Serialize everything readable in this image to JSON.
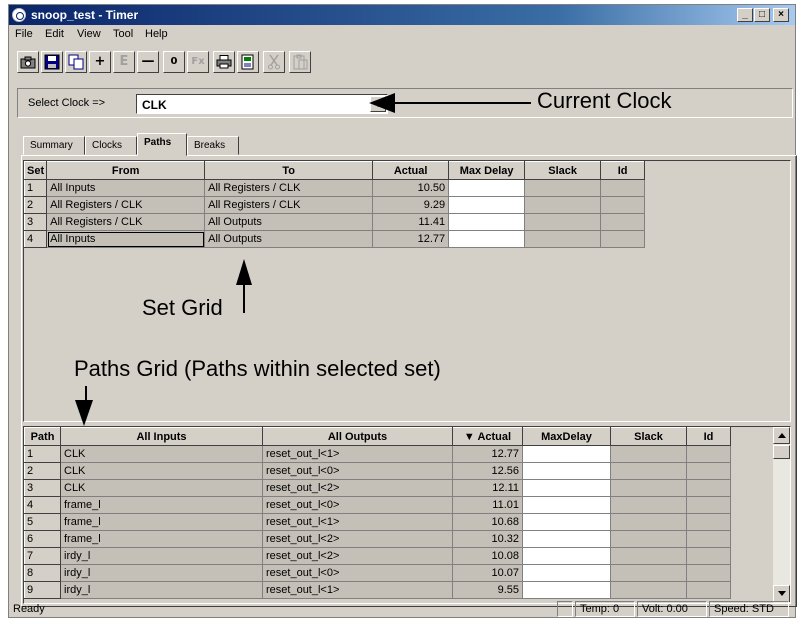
{
  "window": {
    "title": "snoop_test - Timer",
    "controls": {
      "minimize": "_",
      "maximize": "□",
      "close": "×"
    }
  },
  "menu": [
    "File",
    "Edit",
    "View",
    "Tool",
    "Help"
  ],
  "toolbar": {
    "icons": [
      "camera-icon",
      "save-icon",
      "copy-icon",
      "plus-icon",
      "e-icon",
      "minus-icon",
      "zero-icon",
      "fx-icon",
      "print-icon",
      "preview-icon",
      "cut-icon",
      "paste-icon"
    ],
    "labels": [
      "",
      "",
      "",
      "+",
      "E",
      "—",
      "0",
      "Fx",
      "",
      "",
      "",
      ""
    ]
  },
  "clock": {
    "label": "Select Clock =>",
    "value": "CLK"
  },
  "annotations": {
    "current_clock": "Current Clock",
    "set_grid": "Set Grid",
    "paths_grid": "Paths Grid (Paths within selected set)"
  },
  "tabs": [
    {
      "label": "Summary",
      "active": false
    },
    {
      "label": "Clocks",
      "active": false
    },
    {
      "label": "Paths",
      "active": true
    },
    {
      "label": "Breaks",
      "active": false
    }
  ],
  "set_grid": {
    "headers": [
      "Set",
      "From",
      "To",
      "Actual",
      "Max Delay",
      "Slack",
      "Id"
    ],
    "rows": [
      {
        "set": "1",
        "from": "All Inputs",
        "to": "All Registers / CLK",
        "actual": "10.50",
        "max_delay": "",
        "slack": "",
        "id": ""
      },
      {
        "set": "2",
        "from": "All Registers / CLK",
        "to": "All Registers / CLK",
        "actual": "9.29",
        "max_delay": "",
        "slack": "",
        "id": ""
      },
      {
        "set": "3",
        "from": "All Registers / CLK",
        "to": "All Outputs",
        "actual": "11.41",
        "max_delay": "",
        "slack": "",
        "id": ""
      },
      {
        "set": "4",
        "from": "All Inputs",
        "to": "All Outputs",
        "actual": "12.77",
        "max_delay": "",
        "slack": "",
        "id": ""
      }
    ]
  },
  "paths_grid": {
    "headers": [
      "Path",
      "All Inputs",
      "All Outputs",
      "Actual",
      "MaxDelay",
      "Slack",
      "Id"
    ],
    "sort_indicator": "▼",
    "rows": [
      {
        "path": "1",
        "input": "CLK",
        "output": "reset_out_l<1>",
        "actual": "12.77"
      },
      {
        "path": "2",
        "input": "CLK",
        "output": "reset_out_l<0>",
        "actual": "12.56"
      },
      {
        "path": "3",
        "input": "CLK",
        "output": "reset_out_l<2>",
        "actual": "12.11"
      },
      {
        "path": "4",
        "input": "frame_l",
        "output": "reset_out_l<0>",
        "actual": "11.01"
      },
      {
        "path": "5",
        "input": "frame_l",
        "output": "reset_out_l<1>",
        "actual": "10.68"
      },
      {
        "path": "6",
        "input": "frame_l",
        "output": "reset_out_l<2>",
        "actual": "10.32"
      },
      {
        "path": "7",
        "input": "irdy_l",
        "output": "reset_out_l<2>",
        "actual": "10.08"
      },
      {
        "path": "8",
        "input": "irdy_l",
        "output": "reset_out_l<0>",
        "actual": "10.07"
      },
      {
        "path": "9",
        "input": "irdy_l",
        "output": "reset_out_l<1>",
        "actual": "9.55"
      }
    ]
  },
  "status": {
    "text": "Ready",
    "temp": "Temp: 0",
    "volt": "Volt: 0.00",
    "speed": "Speed: STD"
  }
}
